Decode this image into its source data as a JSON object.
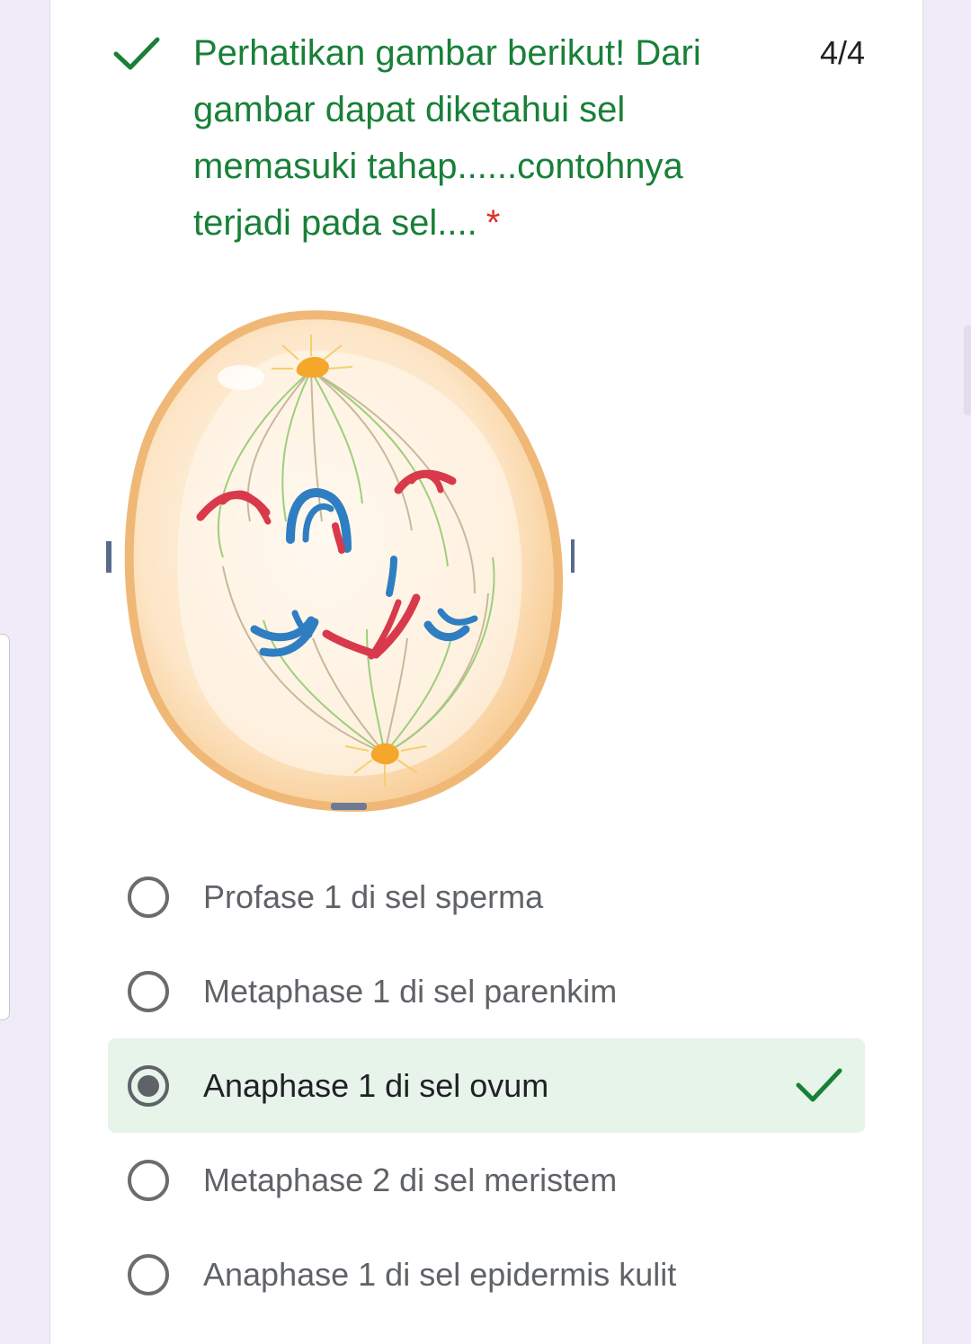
{
  "question": {
    "text": "Perhatikan gambar berikut! Dari gambar dapat diketahui sel memasuki tahap......contohnya terjadi pada sel....",
    "required_marker": "*",
    "score": "4/4",
    "status_icon": "check-icon",
    "status_color": "#188038"
  },
  "figure": {
    "depiction": "anaphase-1-cell"
  },
  "options": [
    {
      "label": "Profase 1 di sel sperma",
      "selected": false,
      "correct": false
    },
    {
      "label": "Metaphase 1 di sel parenkim",
      "selected": false,
      "correct": false
    },
    {
      "label": "Anaphase 1 di sel ovum",
      "selected": true,
      "correct": true
    },
    {
      "label": "Metaphase 2 di sel meristem",
      "selected": false,
      "correct": false
    },
    {
      "label": "Anaphase 1 di sel epidermis kulit",
      "selected": false,
      "correct": false
    }
  ],
  "colors": {
    "correct_green": "#188038",
    "correct_bg": "#e6f4ea",
    "required_red": "#d93025",
    "page_bg": "#f0ebf8"
  }
}
